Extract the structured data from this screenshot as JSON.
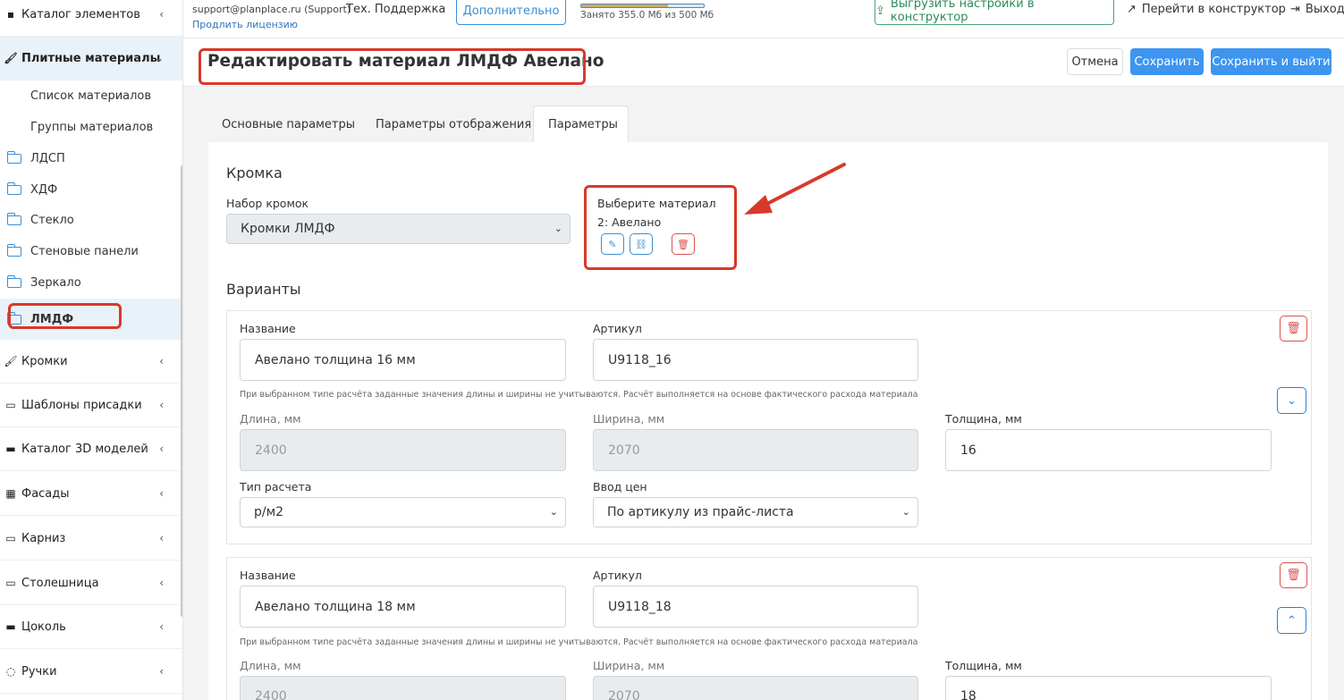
{
  "sidebar": {
    "top_item": "Каталог элементов",
    "active_group": "Плитные материалы",
    "sub_items": [
      "Список материалов",
      "Группы материалов"
    ],
    "folders": [
      "ЛДСП",
      "ХДФ",
      "Стекло",
      "Стеновые панели",
      "Зеркало",
      "ЛМДФ"
    ],
    "groups": [
      "Кромки",
      "Шаблоны присадки",
      "Каталог 3D моделей",
      "Фасады",
      "Карниз",
      "Столешница",
      "Цоколь",
      "Ручки"
    ]
  },
  "topbar": {
    "user_email": "support@planplace.ru (Support)",
    "renew_license": "Продлить лицензию",
    "support": "Тех. Поддержка",
    "additional_button": "Дополнительно",
    "storage_text": "Занято 355.0 Мб из 500 Мб",
    "storage_fraction": 0.71,
    "upload_button": "Выгрузить настройки в конструктор",
    "goto_constructor": "Перейти в конструктор",
    "logout": "Выход"
  },
  "header": {
    "title": "Редактировать материал ЛМДФ Авелано",
    "cancel": "Отмена",
    "save": "Сохранить",
    "save_exit": "Сохранить и выйти"
  },
  "tabs": [
    "Основные параметры",
    "Параметры отображения",
    "Параметры"
  ],
  "edge": {
    "section_title": "Кромка",
    "set_label": "Набор кромок",
    "set_value": "Кромки ЛМДФ",
    "choose_label": "Выберите материал",
    "chosen": "2: Авелано"
  },
  "variants_title": "Варианты",
  "labels": {
    "name": "Название",
    "article": "Артикул",
    "length": "Длина, мм",
    "width": "Ширина, мм",
    "thickness": "Толщина, мм",
    "calc_type": "Тип расчета",
    "price_input": "Ввод цен",
    "hint": "При выбранном типе расчёта заданные значения длины и ширины не учитываются. Расчёт выполняется на основе фактического расхода материала"
  },
  "variants": [
    {
      "name": "Авелано толщина 16 мм",
      "article": "U9118_16",
      "length": "2400",
      "width": "2070",
      "thickness": "16",
      "calc_type": "р/м2",
      "price_input": "По артикулу из прайс-листа"
    },
    {
      "name": "Авелано толщина 18 мм",
      "article": "U9118_18",
      "length": "2400",
      "width": "2070",
      "thickness": "18"
    }
  ]
}
